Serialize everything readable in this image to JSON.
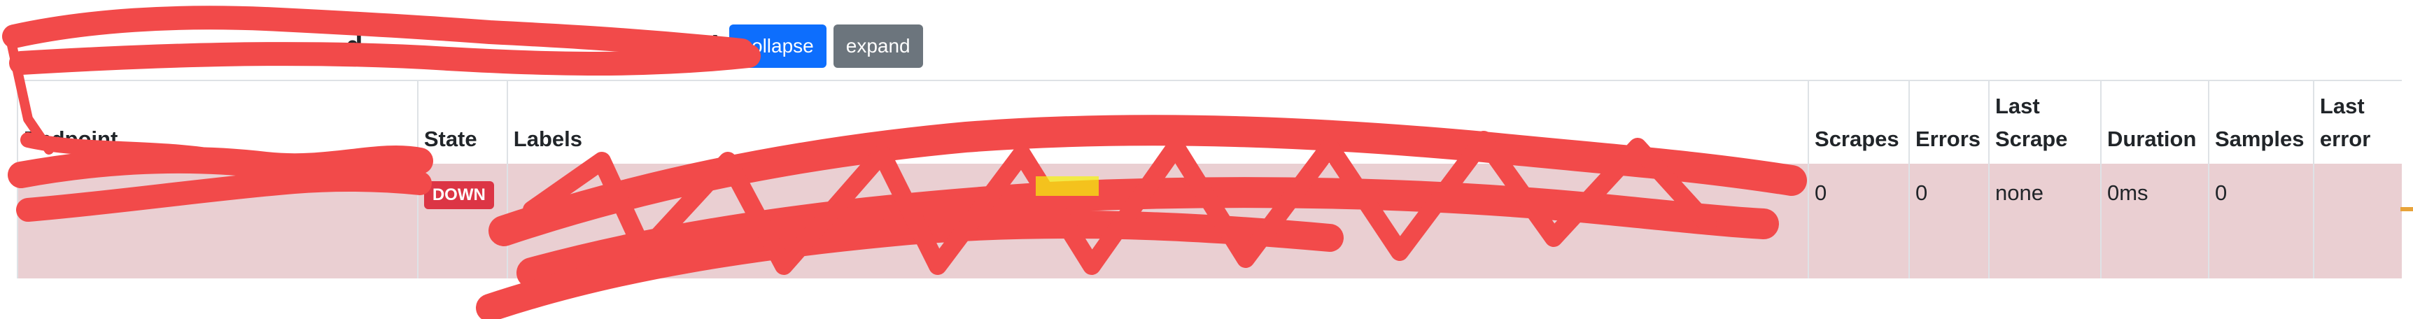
{
  "header": {
    "title_visible_fragment": "d",
    "title_highlighted": "",
    "title_suffix": ")",
    "collapse_label": "collapse",
    "expand_label": "expand"
  },
  "table": {
    "columns": [
      "Endpoint",
      "State",
      "Labels",
      "Scrapes",
      "Errors",
      "Last Scrape",
      "Duration",
      "Samples",
      "Last error"
    ],
    "rows": [
      {
        "endpoint": "",
        "state": "DOWN",
        "labels": "",
        "scrapes": "0",
        "errors": "0",
        "last_scrape": "none",
        "duration": "0ms",
        "samples": "0",
        "last_error": ""
      }
    ]
  },
  "colors": {
    "primary": "#0d6efd",
    "secondary": "#6c757d",
    "danger": "#dc3545",
    "row_error_bg": "#eacfd2",
    "highlight": "#f5f50a",
    "redaction": "#f24a4a"
  }
}
